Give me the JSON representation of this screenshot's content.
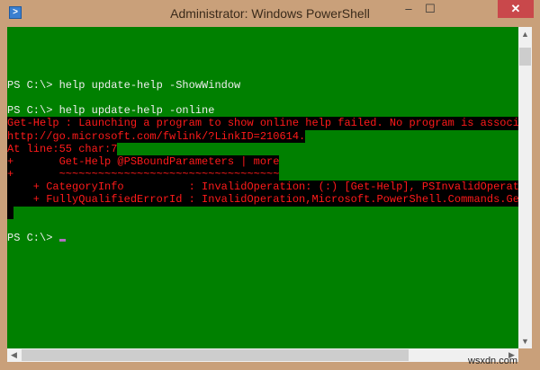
{
  "window": {
    "title": "Administrator: Windows PowerShell",
    "icon": "powershell-icon",
    "minimize": "–",
    "maximize": "☐",
    "close": "✕"
  },
  "console": {
    "colors": {
      "background": "#008000",
      "error": "#ff1a1a",
      "error_bg": "#000000",
      "text": "#eeeeee"
    },
    "lines": [
      "PS C:\\> help update-help -ShowWindow",
      "PS C:\\> help update-help -online",
      "Get-Help : Launching a program to show online help failed. No program is associ",
      "http://go.microsoft.com/fwlink/?LinkID=210614.",
      "At line:55 char:7",
      "+       Get-Help @PSBoundParameters | more",
      "+       ~~~~~~~~~~~~~~~~~~~~~~~~~~~~~~~~~~",
      "    + CategoryInfo          : InvalidOperation: (:) [Get-Help], PSInvalidOperat",
      "    + FullyQualifiedErrorId : InvalidOperation,Microsoft.PowerShell.Commands.Ge",
      "PS C:\\> "
    ]
  },
  "watermark": "wsxdn.com"
}
